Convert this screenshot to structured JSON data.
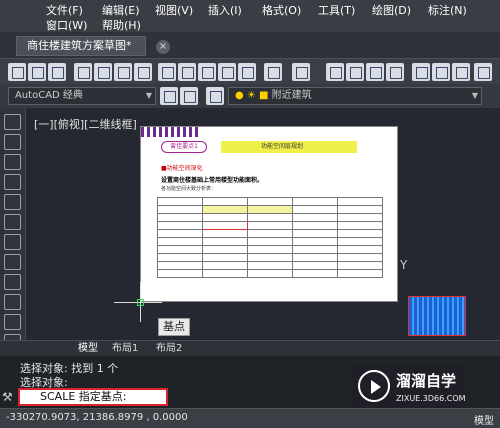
{
  "menu": {
    "row1": [
      "文件(F)",
      "编辑(E)",
      "视图(V)",
      "插入(I)",
      "格式(O)",
      "工具(T)",
      "绘图(D)",
      "标注(N)"
    ],
    "row2": [
      "窗口(W)",
      "帮助(H)"
    ]
  },
  "doc_tab": {
    "title": "商住楼建筑方案草图*",
    "close": "×"
  },
  "workspace": {
    "name": "AutoCAD 经典",
    "layer": "附近建筑"
  },
  "viewport_label": "[一][俯视][二维线框]",
  "paper": {
    "badge": "曾佳要点1",
    "heading": "功能空间层规划",
    "line1": "■功能空间深化",
    "line2": "设置商住楼基础上常用楼型功能面积。",
    "line3": "各功能空间大致分析表："
  },
  "tooltip": "基点",
  "tabs": {
    "model": "模型",
    "layout1": "布局1",
    "layout2": "布局2"
  },
  "command": {
    "line1": "选择对象: 找到 1 个",
    "line2": "选择对象:",
    "input": "SCALE 指定基点:"
  },
  "status": {
    "coords": "-330270.9073, 21386.8979 , 0.0000",
    "right": "模型"
  },
  "watermark": {
    "brand": "溜溜自学",
    "url": "ZIXUE.3D66.COM"
  },
  "axis_y": "Y"
}
